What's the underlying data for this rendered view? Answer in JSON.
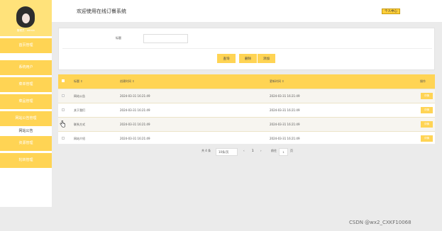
{
  "sidebar": {
    "admin_name": "管理员 · admin",
    "home": "首页管理",
    "items": [
      {
        "label": "系统用户"
      },
      {
        "label": "菜单管理"
      },
      {
        "label": "菜品管理"
      },
      {
        "label": "网站公告管理"
      }
    ],
    "sub_item": "网站公告",
    "items_after": [
      {
        "label": "资源管理"
      },
      {
        "label": "轮转管理"
      }
    ]
  },
  "header": {
    "title": "欢迎使用在线订餐系统",
    "user_center": "个人中心"
  },
  "search": {
    "label": "标题",
    "value": "",
    "placeholder": "",
    "buttons": {
      "query": "查询",
      "delete": "删除",
      "add": "添加"
    }
  },
  "table": {
    "columns": {
      "title": "标题",
      "created": "创建时间",
      "updated": "更新时间",
      "action": "操作"
    },
    "sort_marks": {
      "title": "↕",
      "created": "↕",
      "updated": "↕"
    },
    "rows": [
      {
        "title": "网站公告",
        "created": "2024-03-31 16:21:49",
        "updated": "2024-03-31 16:21:49",
        "action": "详情"
      },
      {
        "title": "关于我们",
        "created": "2024-03-31 16:21:49",
        "updated": "2024-03-31 16:21:49",
        "action": "详情"
      },
      {
        "title": "联系方式",
        "created": "2024-03-31 16:21:49",
        "updated": "2024-03-31 16:21:49",
        "action": "详情"
      },
      {
        "title": "网站介绍",
        "created": "2024-03-31 16:21:49",
        "updated": "2024-03-31 16:21:49",
        "action": "详情"
      }
    ]
  },
  "pagination": {
    "total": "共 4 条",
    "page_size": "10条/页",
    "prev": "‹",
    "current": "1",
    "next": "›",
    "goto_label": "前往",
    "goto_value": "1",
    "page_suffix": "页"
  },
  "watermark": "CSDN @wx2_CXKF10068",
  "colors": {
    "accent": "#ffd454",
    "header_accent": "#ffe27a"
  },
  "icons": {
    "avatar": "avatar-icon",
    "cursor": "hand-cursor-icon"
  }
}
